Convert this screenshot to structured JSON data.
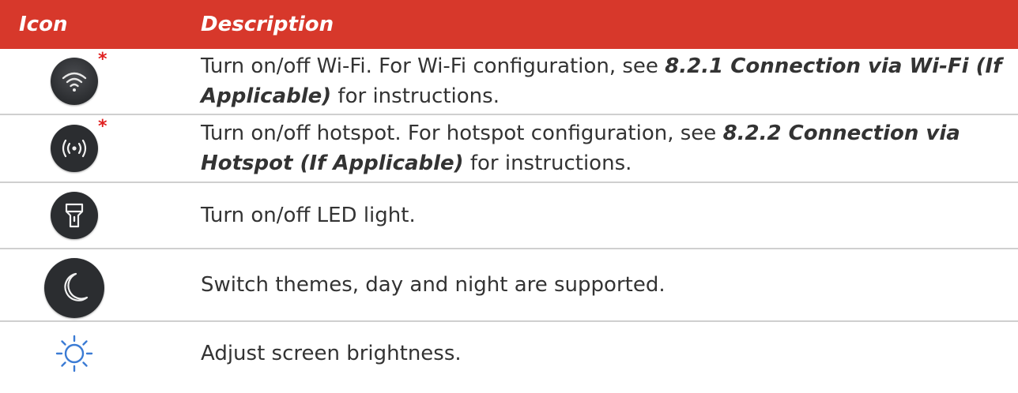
{
  "header": {
    "icon_col": "Icon",
    "desc_col": "Description"
  },
  "rows": [
    {
      "icon": "wifi-icon",
      "asterisk": "*",
      "text_before": "Turn on/off Wi-Fi. For Wi-Fi configuration, see ",
      "ref": "8.2.1 Connection via Wi-Fi (If Applicable)",
      "text_after": " for instructions."
    },
    {
      "icon": "hotspot-icon",
      "asterisk": "*",
      "text_before": "Turn on/off hotspot. For hotspot configuration, see ",
      "ref": "8.2.2 Connection via Hotspot (If Applicable)",
      "text_after": " for instructions."
    },
    {
      "icon": "flashlight-icon",
      "text": "Turn on/off LED light."
    },
    {
      "icon": "moon-icon",
      "text": "Switch themes, day and night are supported."
    },
    {
      "icon": "sun-icon",
      "text": "Adjust screen brightness."
    }
  ],
  "colors": {
    "header_bg": "#d7382b",
    "icon_bg": "#2b2d30",
    "sun_icon": "#3b7bd4",
    "asterisk": "#e02020"
  }
}
